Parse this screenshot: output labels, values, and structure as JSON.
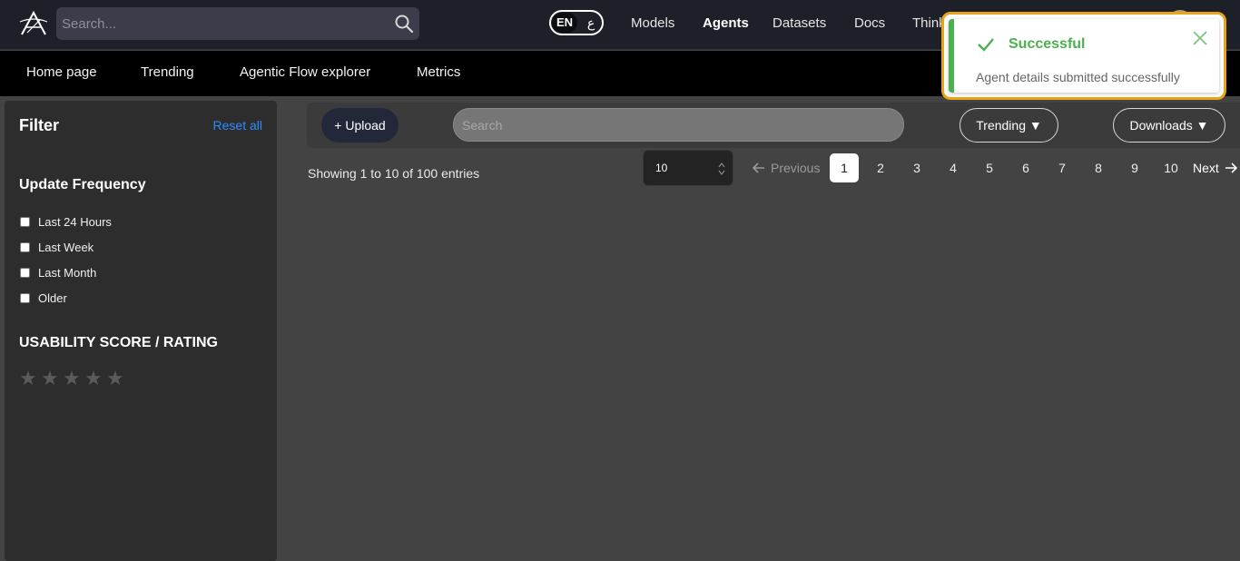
{
  "header": {
    "search_placeholder": "Search...",
    "lang": {
      "en": "EN",
      "ar": "ع"
    },
    "nav": [
      {
        "label": "Models"
      },
      {
        "label": "Agents"
      },
      {
        "label": "Datasets"
      },
      {
        "label": "Docs"
      },
      {
        "label": "Thinktank"
      }
    ],
    "active_nav": "Agents"
  },
  "subnav": [
    "Home page",
    "Trending",
    "Agentic Flow explorer",
    "Metrics"
  ],
  "sidebar": {
    "title": "Filter",
    "reset_label": "Reset all",
    "update_frequency": {
      "title": "Update Frequency",
      "options": [
        "Last 24 Hours",
        "Last Week",
        "Last Month",
        "Older"
      ]
    },
    "usability": {
      "title": "USABILITY SCORE / RATING",
      "rating": 0,
      "max": 5
    }
  },
  "toolbar": {
    "upload_label": "+ Upload",
    "search_placeholder": "Search",
    "trending_label": "Trending ▼",
    "downloads_label": "Downloads ▼"
  },
  "pagination": {
    "showing": "Showing 1 to 10 of 100 entries",
    "page_size": "10",
    "prev_label": "Previous",
    "next_label": "Next",
    "pages": [
      "1",
      "2",
      "3",
      "4",
      "5",
      "6",
      "7",
      "8",
      "9",
      "10"
    ],
    "current_page": "1"
  },
  "toast": {
    "title": "Successful",
    "message": "Agent details submitted successfully"
  },
  "colors": {
    "accent_blue": "#2e8bff",
    "success_green": "#4caf50",
    "toast_highlight": "#e8a317"
  }
}
